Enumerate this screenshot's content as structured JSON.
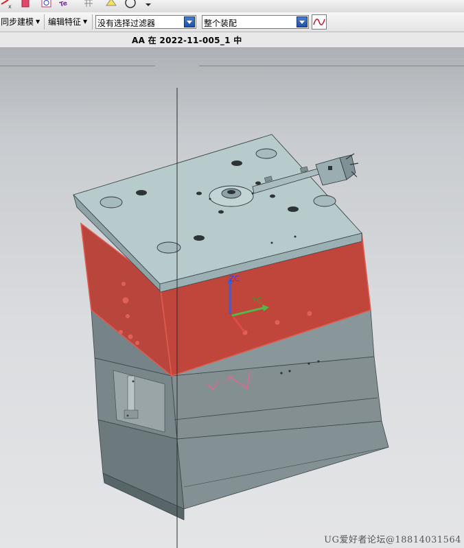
{
  "toolbar": {
    "sync_modeling_label": "同步建模",
    "edit_feature_label": "编辑特征",
    "selection_filter_value": "没有选择过滤器",
    "selection_scope_value": "整个装配"
  },
  "part_bar": {
    "work_part_text": "AA 在 2022-11-005_1 中"
  },
  "viewport": {
    "axis_labels": {
      "z": "ZC",
      "y": "YC"
    },
    "highlight_color": "#c8453b",
    "model_color": "#8a9a9d",
    "plate_top_color": "#b9cdcf"
  },
  "watermark": "UG爱好者论坛@18814031564"
}
